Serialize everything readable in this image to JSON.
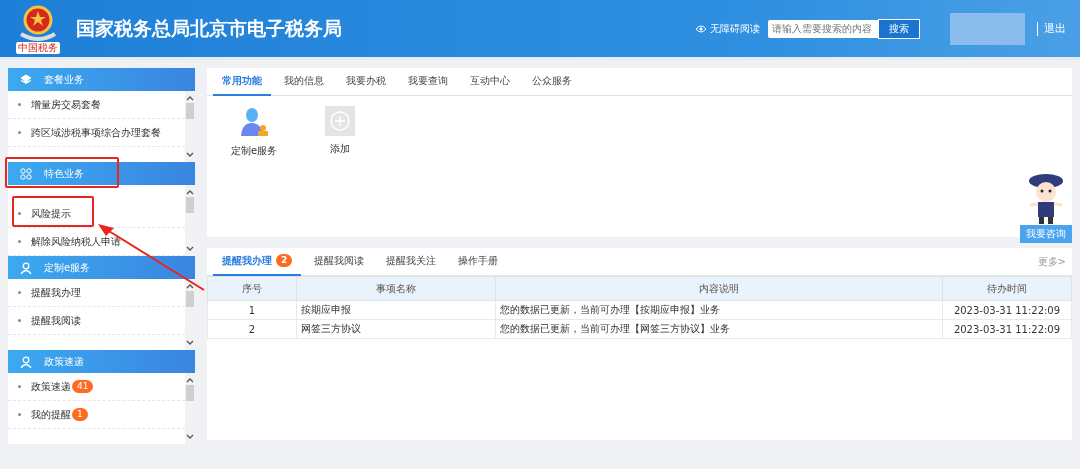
{
  "header": {
    "logo_caption": "中国税务",
    "title": "国家税务总局北京市电子税务局",
    "accessibility": "无障碍阅读",
    "search": {
      "placeholder": "请输入需要搜索的内容",
      "button": "搜索"
    },
    "logout": "退出"
  },
  "sidebar": [
    {
      "title": "套餐业务",
      "items": [
        {
          "label": "增量房交易套餐"
        },
        {
          "label": "跨区域涉税事项综合办理套餐"
        }
      ]
    },
    {
      "title": "特色业务",
      "items": [
        {
          "label": "风险提示"
        },
        {
          "label": "解除风险纳税人申请"
        }
      ]
    },
    {
      "title": "定制e服务",
      "items": [
        {
          "label": "提醒我办理"
        },
        {
          "label": "提醒我阅读"
        }
      ]
    },
    {
      "title": "政策速递",
      "items": [
        {
          "label": "政策速递",
          "badge": "41"
        },
        {
          "label": "我的提醒",
          "badge": "1"
        }
      ]
    }
  ],
  "top_panel": {
    "tabs": [
      {
        "label": "常用功能",
        "selected": true
      },
      {
        "label": "我的信息",
        "selected": false
      },
      {
        "label": "我要办税",
        "selected": false
      },
      {
        "label": "我要查询",
        "selected": false
      },
      {
        "label": "互动中心",
        "selected": false
      },
      {
        "label": "公众服务",
        "selected": false
      }
    ],
    "shortcuts": [
      {
        "kind": "service",
        "label": "定制e服务"
      },
      {
        "kind": "add",
        "label": "添加"
      }
    ]
  },
  "assistant": {
    "button": "我要咨询"
  },
  "bottom_panel": {
    "tabs": [
      {
        "label": "提醒我办理",
        "badge": "2",
        "selected": true
      },
      {
        "label": "提醒我阅读",
        "selected": false
      },
      {
        "label": "提醒我关注",
        "selected": false
      },
      {
        "label": "操作手册",
        "selected": false
      }
    ],
    "more": "更多>",
    "table": {
      "columns": [
        "序号",
        "事项名称",
        "内容说明",
        "待办时间"
      ],
      "rows": [
        [
          "1",
          "按期应申报",
          "您的数据已更新，当前可办理【按期应申报】业务",
          "2023-03-31 11:22:09"
        ],
        [
          "2",
          "网签三方协议",
          "您的数据已更新，当前可办理【网签三方协议】业务",
          "2023-03-31 11:22:09"
        ]
      ]
    }
  }
}
